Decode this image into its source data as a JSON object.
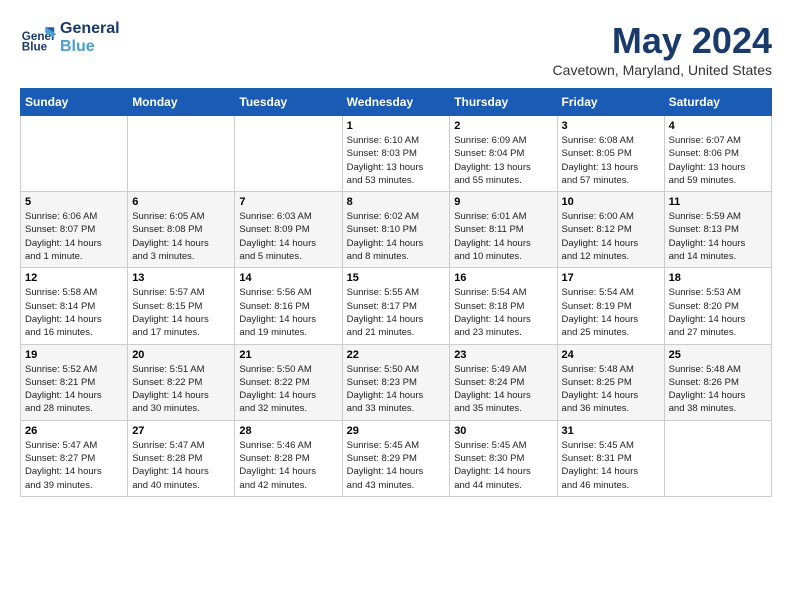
{
  "header": {
    "logo_line1": "General",
    "logo_line2": "Blue",
    "month_year": "May 2024",
    "location": "Cavetown, Maryland, United States"
  },
  "weekdays": [
    "Sunday",
    "Monday",
    "Tuesday",
    "Wednesday",
    "Thursday",
    "Friday",
    "Saturday"
  ],
  "weeks": [
    [
      {
        "day": "",
        "info": ""
      },
      {
        "day": "",
        "info": ""
      },
      {
        "day": "",
        "info": ""
      },
      {
        "day": "1",
        "info": "Sunrise: 6:10 AM\nSunset: 8:03 PM\nDaylight: 13 hours\nand 53 minutes."
      },
      {
        "day": "2",
        "info": "Sunrise: 6:09 AM\nSunset: 8:04 PM\nDaylight: 13 hours\nand 55 minutes."
      },
      {
        "day": "3",
        "info": "Sunrise: 6:08 AM\nSunset: 8:05 PM\nDaylight: 13 hours\nand 57 minutes."
      },
      {
        "day": "4",
        "info": "Sunrise: 6:07 AM\nSunset: 8:06 PM\nDaylight: 13 hours\nand 59 minutes."
      }
    ],
    [
      {
        "day": "5",
        "info": "Sunrise: 6:06 AM\nSunset: 8:07 PM\nDaylight: 14 hours\nand 1 minute."
      },
      {
        "day": "6",
        "info": "Sunrise: 6:05 AM\nSunset: 8:08 PM\nDaylight: 14 hours\nand 3 minutes."
      },
      {
        "day": "7",
        "info": "Sunrise: 6:03 AM\nSunset: 8:09 PM\nDaylight: 14 hours\nand 5 minutes."
      },
      {
        "day": "8",
        "info": "Sunrise: 6:02 AM\nSunset: 8:10 PM\nDaylight: 14 hours\nand 8 minutes."
      },
      {
        "day": "9",
        "info": "Sunrise: 6:01 AM\nSunset: 8:11 PM\nDaylight: 14 hours\nand 10 minutes."
      },
      {
        "day": "10",
        "info": "Sunrise: 6:00 AM\nSunset: 8:12 PM\nDaylight: 14 hours\nand 12 minutes."
      },
      {
        "day": "11",
        "info": "Sunrise: 5:59 AM\nSunset: 8:13 PM\nDaylight: 14 hours\nand 14 minutes."
      }
    ],
    [
      {
        "day": "12",
        "info": "Sunrise: 5:58 AM\nSunset: 8:14 PM\nDaylight: 14 hours\nand 16 minutes."
      },
      {
        "day": "13",
        "info": "Sunrise: 5:57 AM\nSunset: 8:15 PM\nDaylight: 14 hours\nand 17 minutes."
      },
      {
        "day": "14",
        "info": "Sunrise: 5:56 AM\nSunset: 8:16 PM\nDaylight: 14 hours\nand 19 minutes."
      },
      {
        "day": "15",
        "info": "Sunrise: 5:55 AM\nSunset: 8:17 PM\nDaylight: 14 hours\nand 21 minutes."
      },
      {
        "day": "16",
        "info": "Sunrise: 5:54 AM\nSunset: 8:18 PM\nDaylight: 14 hours\nand 23 minutes."
      },
      {
        "day": "17",
        "info": "Sunrise: 5:54 AM\nSunset: 8:19 PM\nDaylight: 14 hours\nand 25 minutes."
      },
      {
        "day": "18",
        "info": "Sunrise: 5:53 AM\nSunset: 8:20 PM\nDaylight: 14 hours\nand 27 minutes."
      }
    ],
    [
      {
        "day": "19",
        "info": "Sunrise: 5:52 AM\nSunset: 8:21 PM\nDaylight: 14 hours\nand 28 minutes."
      },
      {
        "day": "20",
        "info": "Sunrise: 5:51 AM\nSunset: 8:22 PM\nDaylight: 14 hours\nand 30 minutes."
      },
      {
        "day": "21",
        "info": "Sunrise: 5:50 AM\nSunset: 8:22 PM\nDaylight: 14 hours\nand 32 minutes."
      },
      {
        "day": "22",
        "info": "Sunrise: 5:50 AM\nSunset: 8:23 PM\nDaylight: 14 hours\nand 33 minutes."
      },
      {
        "day": "23",
        "info": "Sunrise: 5:49 AM\nSunset: 8:24 PM\nDaylight: 14 hours\nand 35 minutes."
      },
      {
        "day": "24",
        "info": "Sunrise: 5:48 AM\nSunset: 8:25 PM\nDaylight: 14 hours\nand 36 minutes."
      },
      {
        "day": "25",
        "info": "Sunrise: 5:48 AM\nSunset: 8:26 PM\nDaylight: 14 hours\nand 38 minutes."
      }
    ],
    [
      {
        "day": "26",
        "info": "Sunrise: 5:47 AM\nSunset: 8:27 PM\nDaylight: 14 hours\nand 39 minutes."
      },
      {
        "day": "27",
        "info": "Sunrise: 5:47 AM\nSunset: 8:28 PM\nDaylight: 14 hours\nand 40 minutes."
      },
      {
        "day": "28",
        "info": "Sunrise: 5:46 AM\nSunset: 8:28 PM\nDaylight: 14 hours\nand 42 minutes."
      },
      {
        "day": "29",
        "info": "Sunrise: 5:45 AM\nSunset: 8:29 PM\nDaylight: 14 hours\nand 43 minutes."
      },
      {
        "day": "30",
        "info": "Sunrise: 5:45 AM\nSunset: 8:30 PM\nDaylight: 14 hours\nand 44 minutes."
      },
      {
        "day": "31",
        "info": "Sunrise: 5:45 AM\nSunset: 8:31 PM\nDaylight: 14 hours\nand 46 minutes."
      },
      {
        "day": "",
        "info": ""
      }
    ]
  ]
}
